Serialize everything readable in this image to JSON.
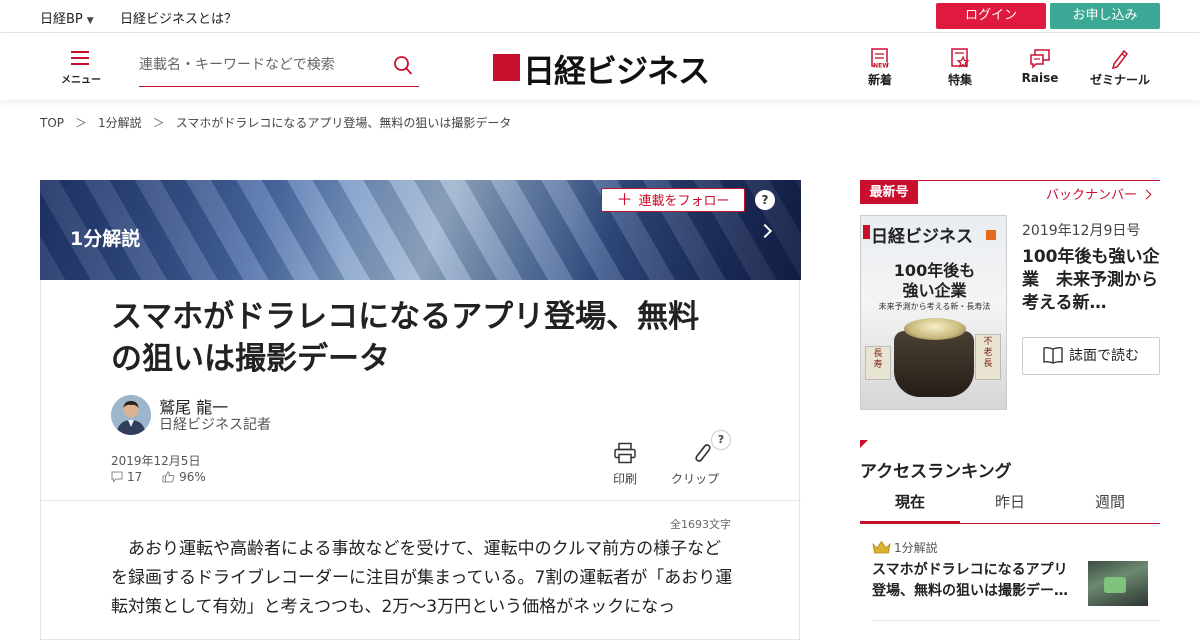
{
  "topbar": {
    "nikkei_bp": "日経BP",
    "about": "日経ビジネスとは？",
    "login": "ログイン",
    "apply": "お申し込み"
  },
  "header": {
    "menu_label": "メニュー",
    "search_placeholder": "連載名・キーワードなどで検索",
    "logo_text": "日経ビジネス",
    "nav": [
      {
        "label": "新着",
        "icon": "new-icon"
      },
      {
        "label": "特集",
        "icon": "feature-icon"
      },
      {
        "label": "Raise",
        "icon": "raise-icon"
      },
      {
        "label": "ゼミナール",
        "icon": "seminar-icon"
      }
    ]
  },
  "breadcrumb": [
    "TOP",
    "1分解説",
    "スマホがドラレコになるアプリ登場、無料の狙いは撮影データ"
  ],
  "breadcrumb_sep": "＞",
  "article": {
    "series": "1分解説",
    "follow_label": "連載をフォロー",
    "help": "?",
    "title": "スマホがドラレコになるアプリ登場、無料の狙いは撮影データ",
    "author_name": "鷲尾 龍一",
    "author_role": "日経ビジネス記者",
    "date": "2019年12月5日",
    "comments": "17",
    "likes": "96%",
    "print_label": "印刷",
    "clip_label": "クリップ",
    "char_count": "全1693文字",
    "body": "あおり運転や高齢者による事故などを受けて、運転中のクルマ前方の様子などを録画するドライブレコーダーに注目が集まっている。7割の運転者が「あおり運転対策として有効」と考えつつも、2万～3万円という価格がネックになっ"
  },
  "sidebar": {
    "latest_tag": "最新号",
    "backnumber": "バックナンバー",
    "cover": {
      "logo": "日経ビジネス",
      "headline": "100年後も\n強い企業",
      "sub": "未来予測から考える新・長寿法"
    },
    "issue_date": "2019年12月9日号",
    "issue_title": "100年後も強い企業　未来予測から考える新…",
    "read_label": "誌面で読む",
    "ranking_title": "アクセスランキング",
    "tabs": [
      "現在",
      "昨日",
      "週間"
    ],
    "active_tab": 0,
    "rank_items": [
      {
        "category": "1分解説",
        "title": "スマホがドラレコになるアプリ登場、無料の狙いは撮影デー…"
      }
    ]
  },
  "colors": {
    "brand_red": "#c8102e",
    "login": "#e0193f",
    "apply": "#3aa894"
  }
}
